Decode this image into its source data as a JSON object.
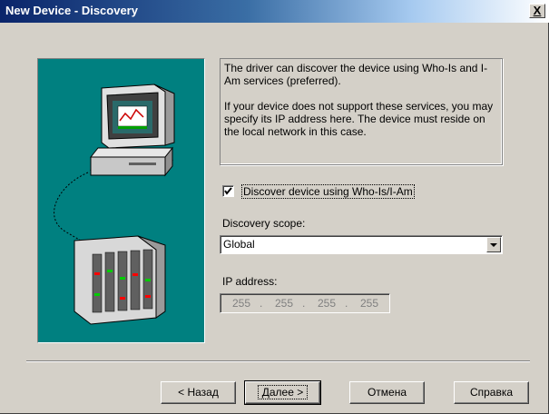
{
  "window": {
    "title": "New Device - Discovery",
    "close_glyph": "X"
  },
  "info": {
    "paragraph1": "The driver can discover the device using Who-Is and I-Am services (preferred).",
    "paragraph2": "If your device does not support these services, you may specify its IP address here. The device must reside on the local network in this case."
  },
  "discover_checkbox": {
    "label": "Discover device using Who-Is/I-Am",
    "checked": true
  },
  "scope": {
    "label": "Discovery scope:",
    "value": "Global"
  },
  "ip": {
    "label": "IP address:",
    "octets": [
      "255",
      "255",
      "255",
      "255"
    ],
    "disabled": true
  },
  "buttons": {
    "back": "< Назад",
    "next": "Далее >",
    "cancel": "Отмена",
    "help": "Справка"
  },
  "colors": {
    "panel_bg": "#d4d0c8",
    "illustration_bg": "#008080",
    "title_bar": "#0a246a"
  },
  "icons": {
    "illustration": "computer-and-device-network-illustration"
  }
}
